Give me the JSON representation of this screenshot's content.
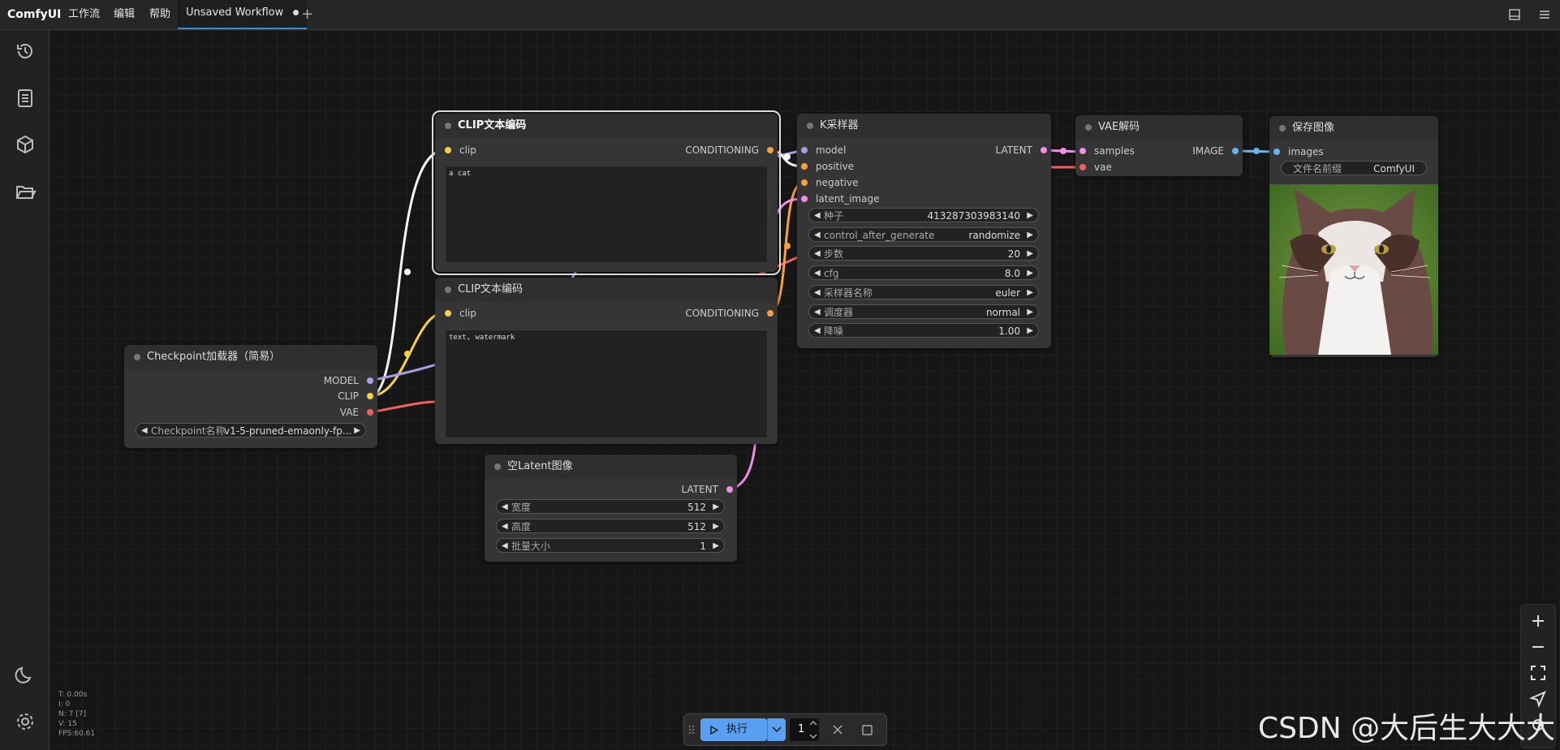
{
  "topbar": {
    "logo": "ComfyUI",
    "menu": [
      "工作流",
      "编辑",
      "帮助"
    ],
    "active_tab": "Unsaved Workflow",
    "add_tab": "+"
  },
  "sidebar": {
    "icons": [
      "history-icon",
      "queue-icon",
      "model-library-icon",
      "workflows-icon",
      "theme-moon-icon",
      "settings-gear-icon"
    ]
  },
  "nodes": {
    "clip_pos": {
      "title": "CLIP文本编码",
      "in_clip": "clip",
      "out": "CONDITIONING",
      "text": "a cat"
    },
    "clip_neg": {
      "title": "CLIP文本编码",
      "in_clip": "clip",
      "out": "CONDITIONING",
      "text": "text, watermark"
    },
    "checkpoint": {
      "title": "Checkpoint加载器（简易）",
      "out_model": "MODEL",
      "out_clip": "CLIP",
      "out_vae": "VAE",
      "widget_label": "Checkpoint名称",
      "widget_value": "v1-5-pruned-emaonly-fp..."
    },
    "latent": {
      "title": "空Latent图像",
      "out": "LATENT",
      "widgets": [
        {
          "label": "宽度",
          "value": "512"
        },
        {
          "label": "高度",
          "value": "512"
        },
        {
          "label": "批量大小",
          "value": "1"
        }
      ]
    },
    "ksampler": {
      "title": "K采样器",
      "inputs": [
        "model",
        "positive",
        "negative",
        "latent_image"
      ],
      "out": "LATENT",
      "widgets": [
        {
          "label": "种子",
          "value": "413287303983140"
        },
        {
          "label": "control_after_generate",
          "value": "randomize"
        },
        {
          "label": "步数",
          "value": "20"
        },
        {
          "label": "cfg",
          "value": "8.0"
        },
        {
          "label": "采样器名称",
          "value": "euler"
        },
        {
          "label": "调度器",
          "value": "normal"
        },
        {
          "label": "降噪",
          "value": "1.00"
        }
      ]
    },
    "vae_decode": {
      "title": "VAE解码",
      "in_samples": "samples",
      "in_vae": "vae",
      "out": "IMAGE"
    },
    "save_image": {
      "title": "保存图像",
      "in_images": "images",
      "widget_label": "文件名前缀",
      "widget_value": "ComfyUI"
    }
  },
  "stats": [
    "T: 0.00s",
    "I: 0",
    "N: 7 [7]",
    "V: 15",
    "FPS:60.61"
  ],
  "runbar": {
    "run_label": "执行",
    "batch_count": "1"
  },
  "watermark": "CSDN @大后生大大大",
  "colors": {
    "model": "#a99ee6",
    "clip": "#f6d24a",
    "vae": "#f06060",
    "conditioning": "#f5a23c",
    "latent": "#f08ee6",
    "image": "#64b5f6",
    "accent": "#5aa0f0"
  }
}
